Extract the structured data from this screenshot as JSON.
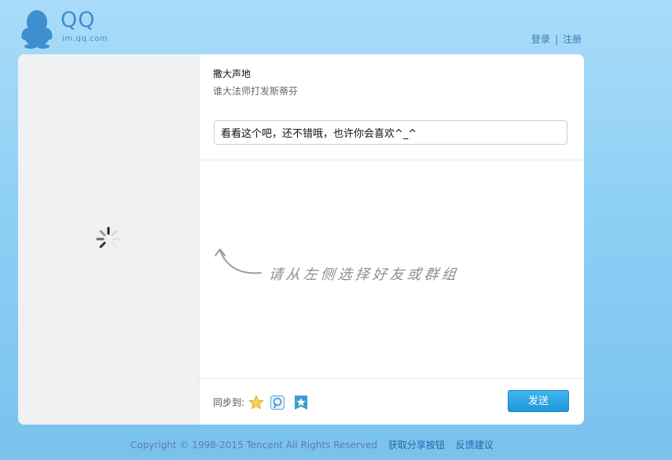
{
  "header": {
    "brand": "QQ",
    "domain": "im.qq.com",
    "login_label": "登录",
    "separator": "|",
    "register_label": "注册"
  },
  "share": {
    "title": "撒大声地",
    "description": "谁大法师打发斯蒂芬",
    "message": "看看这个吧，还不错哦，也许你会喜欢^_^",
    "hint": "请从左侧选择好友或群组"
  },
  "sync": {
    "label": "同步到:",
    "targets": [
      "qzone-star-icon",
      "tencent-weibo-icon",
      "favorites-icon"
    ]
  },
  "send_label": "发送",
  "footer": {
    "copyright": "Copyright © 1998-2015 Tencent All Rights Reserved",
    "link_get_button": "获取分享按钮",
    "link_feedback": "反馈建议"
  },
  "colors": {
    "brand_blue": "#3e8fd0",
    "send_button": "#1f97d9",
    "background": "#8ed0f5"
  }
}
